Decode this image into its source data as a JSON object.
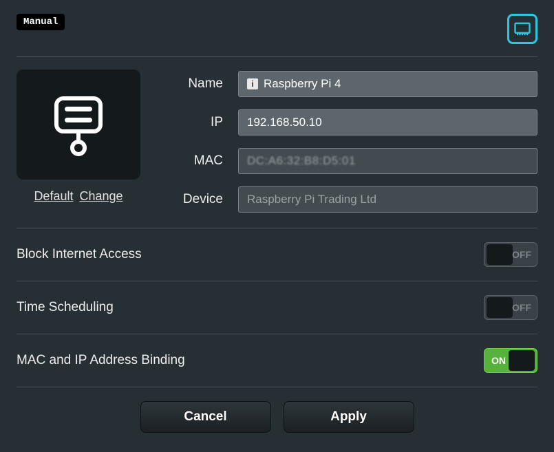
{
  "topbar": {
    "badge": "Manual"
  },
  "device": {
    "default_link": "Default",
    "change_link": "Change"
  },
  "form": {
    "name_label": "Name",
    "name_value": "Raspberry Pi 4",
    "ip_label": "IP",
    "ip_value": "192.168.50.10",
    "mac_label": "MAC",
    "mac_value": "DC:A6:32:B8:D5:01",
    "device_label": "Device",
    "device_value": "Raspberry Pi Trading Ltd"
  },
  "options": {
    "block_internet_label": "Block Internet Access",
    "block_internet_state": "OFF",
    "time_sched_label": "Time Scheduling",
    "time_sched_state": "OFF",
    "mac_ip_bind_label": "MAC and IP Address Binding",
    "mac_ip_bind_state": "ON"
  },
  "buttons": {
    "cancel": "Cancel",
    "apply": "Apply"
  }
}
